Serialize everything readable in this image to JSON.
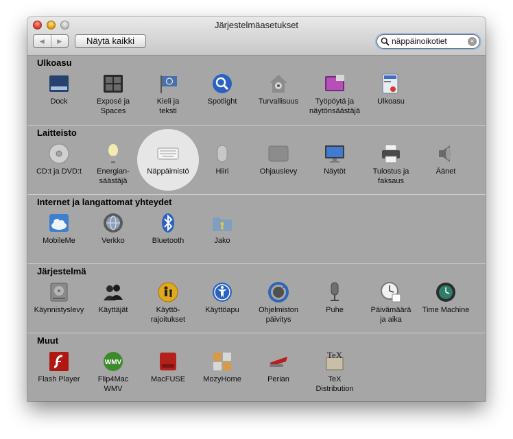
{
  "window": {
    "title": "Järjestelmäasetukset"
  },
  "toolbar": {
    "back": "◀",
    "forward": "▶",
    "show_all": "Näytä kaikki"
  },
  "search": {
    "value": "näppäinoikotiet",
    "clear": "×"
  },
  "sections": [
    {
      "title": "Ulkoasu",
      "items": [
        {
          "label": "Dock",
          "icon": "dock-icon"
        },
        {
          "label": "Exposé ja\nSpaces",
          "icon": "expose-icon"
        },
        {
          "label": "Kieli ja\nteksti",
          "icon": "flag-icon"
        },
        {
          "label": "Spotlight",
          "icon": "spotlight-icon"
        },
        {
          "label": "Turvallisuus",
          "icon": "house-lock-icon"
        },
        {
          "label": "Työpöytä ja\nnäytönsäästäjä",
          "icon": "desktop-icon"
        },
        {
          "label": "Ulkoasu",
          "icon": "appearance-icon"
        }
      ]
    },
    {
      "title": "Laitteisto",
      "items": [
        {
          "label": "CD:t ja DVD:t",
          "icon": "disc-icon"
        },
        {
          "label": "Energian-\nsäästäjä",
          "icon": "bulb-icon"
        },
        {
          "label": "Näppäimistö",
          "icon": "keyboard-icon",
          "highlighted": true
        },
        {
          "label": "Hiiri",
          "icon": "mouse-icon"
        },
        {
          "label": "Ohjauslevy",
          "icon": "trackpad-icon"
        },
        {
          "label": "Näytöt",
          "icon": "monitor-icon"
        },
        {
          "label": "Tulostus ja\nfaksaus",
          "icon": "printer-icon"
        },
        {
          "label": "Äänet",
          "icon": "speaker-icon"
        }
      ]
    },
    {
      "title": "Internet ja langattomat yhteydet",
      "items": [
        {
          "label": "MobileMe",
          "icon": "cloud-icon"
        },
        {
          "label": "Verkko",
          "icon": "globe-icon"
        },
        {
          "label": "Bluetooth",
          "icon": "bluetooth-icon"
        },
        {
          "label": "Jako",
          "icon": "sharing-folder-icon"
        }
      ]
    },
    {
      "title": "Järjestelmä",
      "items": [
        {
          "label": "Käynnistyslevy",
          "icon": "harddisk-icon"
        },
        {
          "label": "Käyttäjät",
          "icon": "users-icon"
        },
        {
          "label": "Käyttö-\nrajoitukset",
          "icon": "parental-icon"
        },
        {
          "label": "Käyttöapu",
          "icon": "accessibility-icon"
        },
        {
          "label": "Ohjelmiston\npäivitys",
          "icon": "update-icon"
        },
        {
          "label": "Puhe",
          "icon": "microphone-icon"
        },
        {
          "label": "Päivämäärä\nja aika",
          "icon": "clock-icon"
        },
        {
          "label": "Time Machine",
          "icon": "timemachine-icon"
        }
      ]
    },
    {
      "title": "Muut",
      "items": [
        {
          "label": "Flash Player",
          "icon": "flash-icon"
        },
        {
          "label": "Flip4Mac\nWMV",
          "icon": "wmv-icon"
        },
        {
          "label": "MacFUSE",
          "icon": "macfuse-icon"
        },
        {
          "label": "MozyHome",
          "icon": "mozy-icon"
        },
        {
          "label": "Perian",
          "icon": "perian-icon"
        },
        {
          "label": "TeX\nDistribution",
          "icon": "tex-icon"
        }
      ]
    }
  ]
}
